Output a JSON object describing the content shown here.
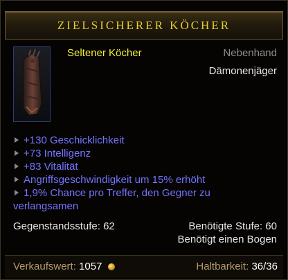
{
  "title": "ZIELSICHERER KÖCHER",
  "rarity": "Seltener Köcher",
  "slot": "Nebenhand",
  "class": "Dämonenjäger",
  "affixes": [
    "+130 Geschicklichkeit",
    "+73 Intelligenz",
    "+83 Vitalität",
    "Angriffsgeschwindigkeit um 15% erhöht",
    "1,9% Chance pro Treffer, den Gegner zu",
    "verlangsamen"
  ],
  "item_level": "Gegenstandsstufe: 62",
  "required_level": "Benötigte Stufe: 60",
  "requirement": "Benötigt einen Bogen",
  "sell_label": "Verkaufswert:",
  "sell_value": "1057",
  "durability_label": "Haltbarkeit:",
  "durability_value": "36/36",
  "colors": {
    "title": "#e4cd2f",
    "rare": "#f2ee3a",
    "affix": "#7474ff",
    "footer_label": "#b49a6a"
  },
  "icons": [
    "quiver-icon",
    "gold-coin-icon",
    "affix-bullet-icon"
  ]
}
